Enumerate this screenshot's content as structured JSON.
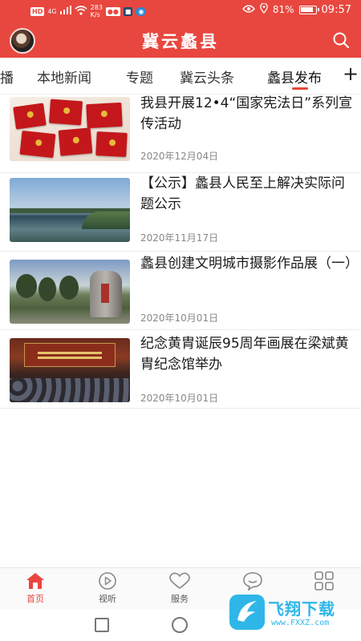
{
  "status_bar": {
    "left_chips": [
      "HD",
      "4G"
    ],
    "net_speed": "283",
    "net_unit": "K/s",
    "battery": "81%",
    "time": "09:57"
  },
  "header": {
    "title": "冀云蠡县"
  },
  "tabs": [
    {
      "label": "播"
    },
    {
      "label": "本地新闻"
    },
    {
      "label": "专题"
    },
    {
      "label": "冀云头条"
    },
    {
      "label": "蠡县发布",
      "active": true
    }
  ],
  "tabs_add_label": "+",
  "news": [
    {
      "title": "我县开展12•4“国家宪法日”系列宣传活动",
      "date": "2020年12月04日"
    },
    {
      "title": "【公示】蠡县人民至上解决实际问题公示",
      "date": "2020年11月17日"
    },
    {
      "title": "蠡县创建文明城市摄影作品展（一）",
      "date": "2020年10月01日"
    },
    {
      "title": "纪念黄胄诞辰95周年画展在梁斌黄胄纪念馆举办",
      "date": "2020年10月01日"
    }
  ],
  "bottom_nav": [
    {
      "label": "首页",
      "icon": "home-icon",
      "active": true
    },
    {
      "label": "视听",
      "icon": "play-icon"
    },
    {
      "label": "服务",
      "icon": "heart-icon"
    },
    {
      "label": "",
      "icon": "chat-icon"
    },
    {
      "label": "",
      "icon": "grid-icon"
    }
  ],
  "watermark": {
    "text": "飞翔下载",
    "url": "www.FXXZ.com"
  },
  "colors": {
    "brand_red": "#e8473f",
    "watermark_blue": "#2fb6e8"
  }
}
